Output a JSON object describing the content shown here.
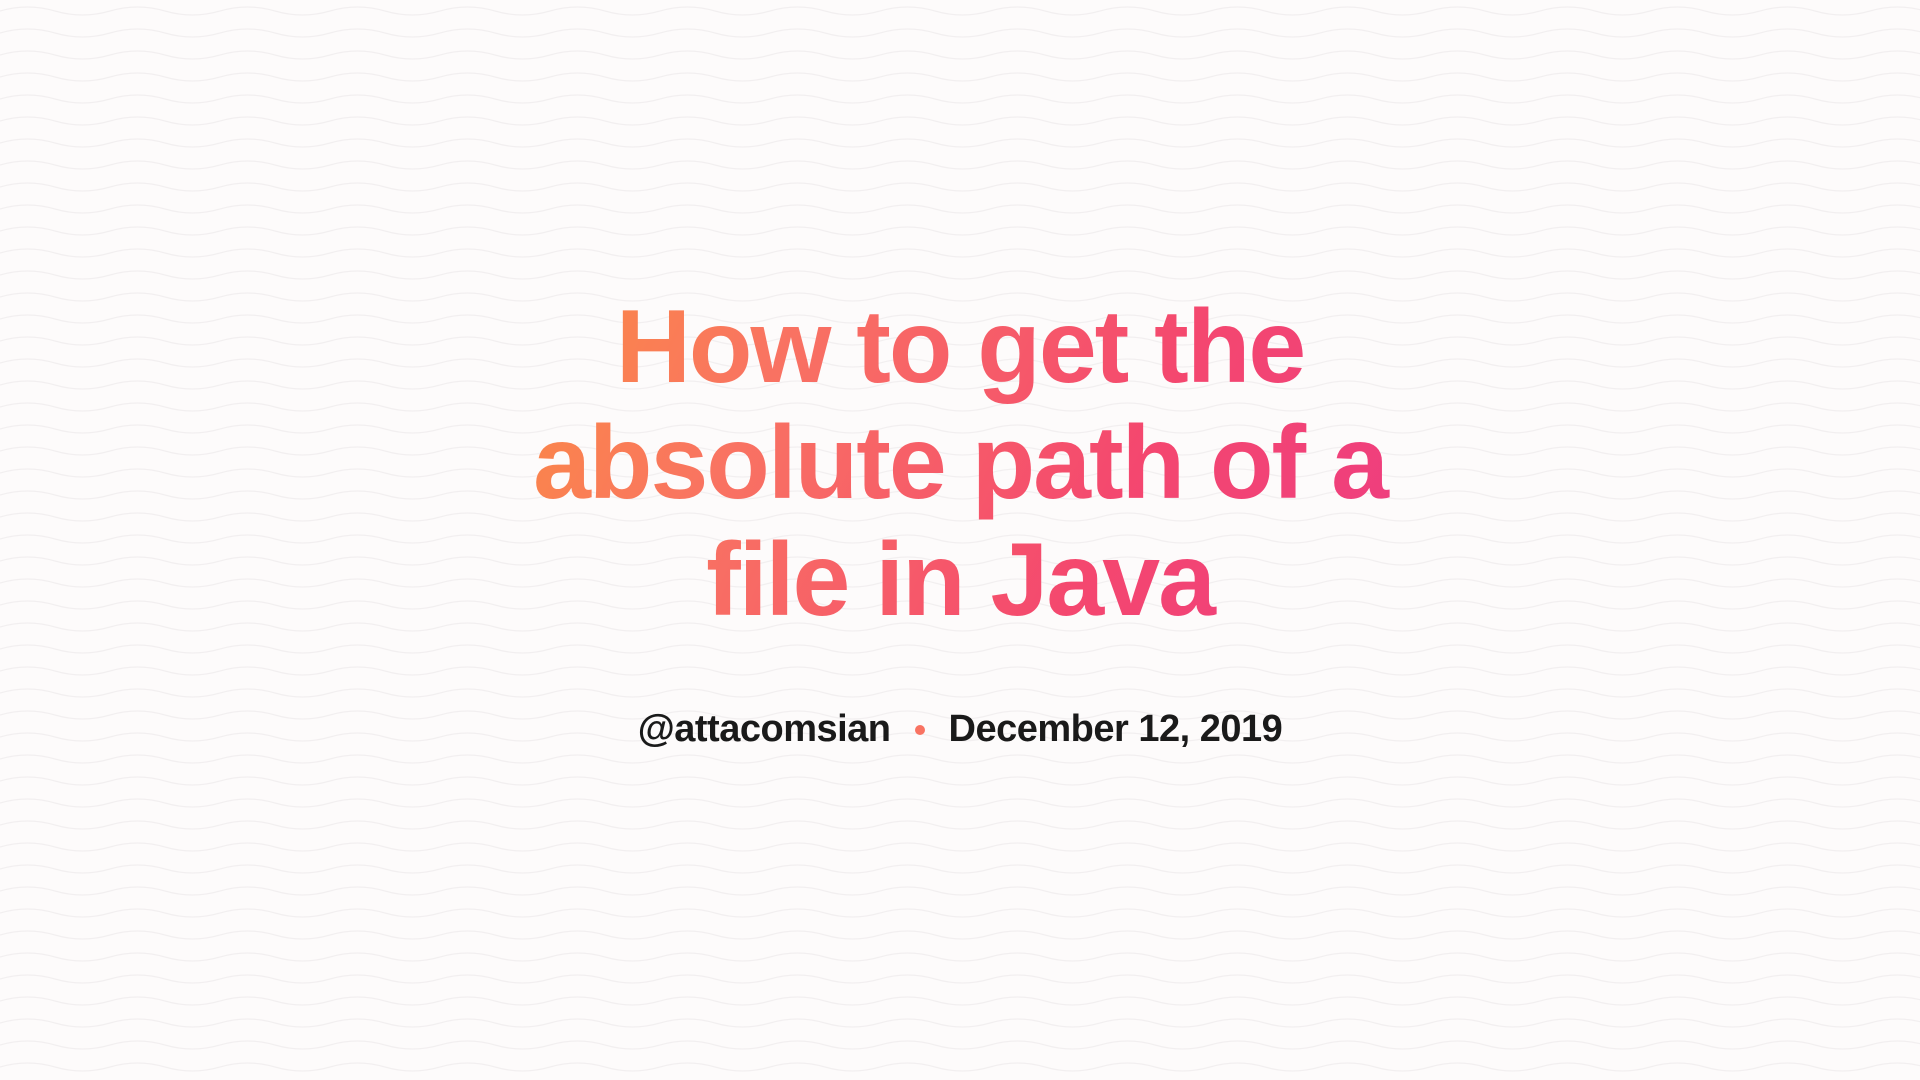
{
  "title": "How to get the absolute path of a file in Java",
  "author": "@attacomsian",
  "date": "December 12, 2019"
}
